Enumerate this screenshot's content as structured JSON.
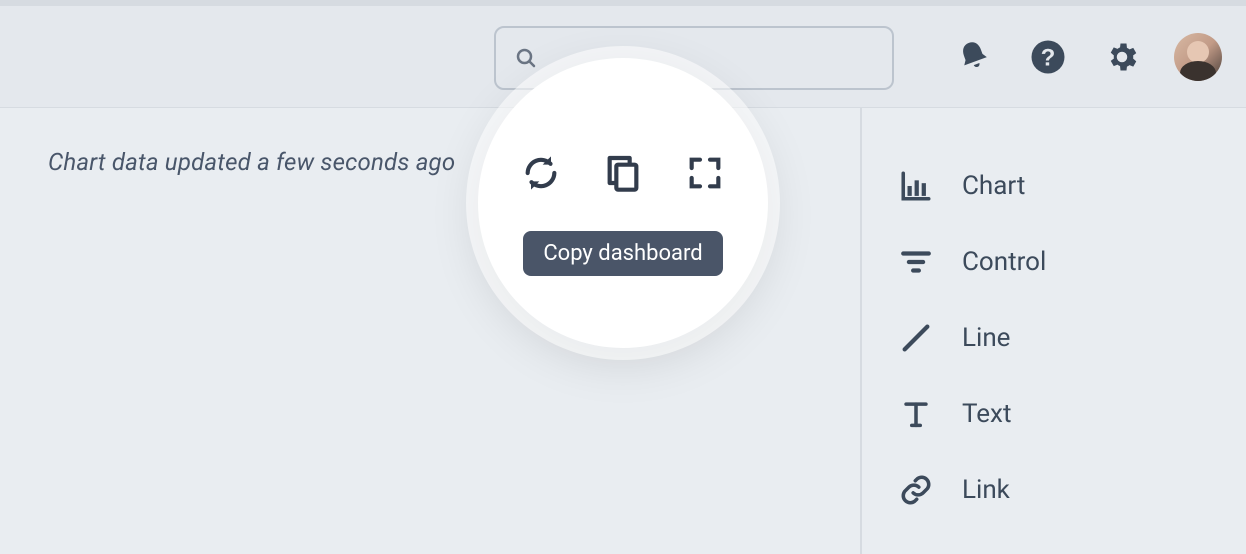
{
  "search": {
    "placeholder": ""
  },
  "icons": {
    "notifications": "bell-icon",
    "help": "help-icon",
    "settings": "gear-icon"
  },
  "status": "Chart data updated a few seconds ago",
  "spotlight": {
    "tooltip": "Copy dashboard",
    "actions": {
      "refresh": "refresh-icon",
      "copy": "copy-icon",
      "fullscreen": "fullscreen-icon"
    }
  },
  "sidebar": {
    "items": [
      {
        "label": "Chart",
        "icon": "chart-icon"
      },
      {
        "label": "Control",
        "icon": "filter-icon"
      },
      {
        "label": "Line",
        "icon": "line-icon"
      },
      {
        "label": "Text",
        "icon": "text-icon"
      },
      {
        "label": "Link",
        "icon": "link-icon"
      }
    ]
  }
}
